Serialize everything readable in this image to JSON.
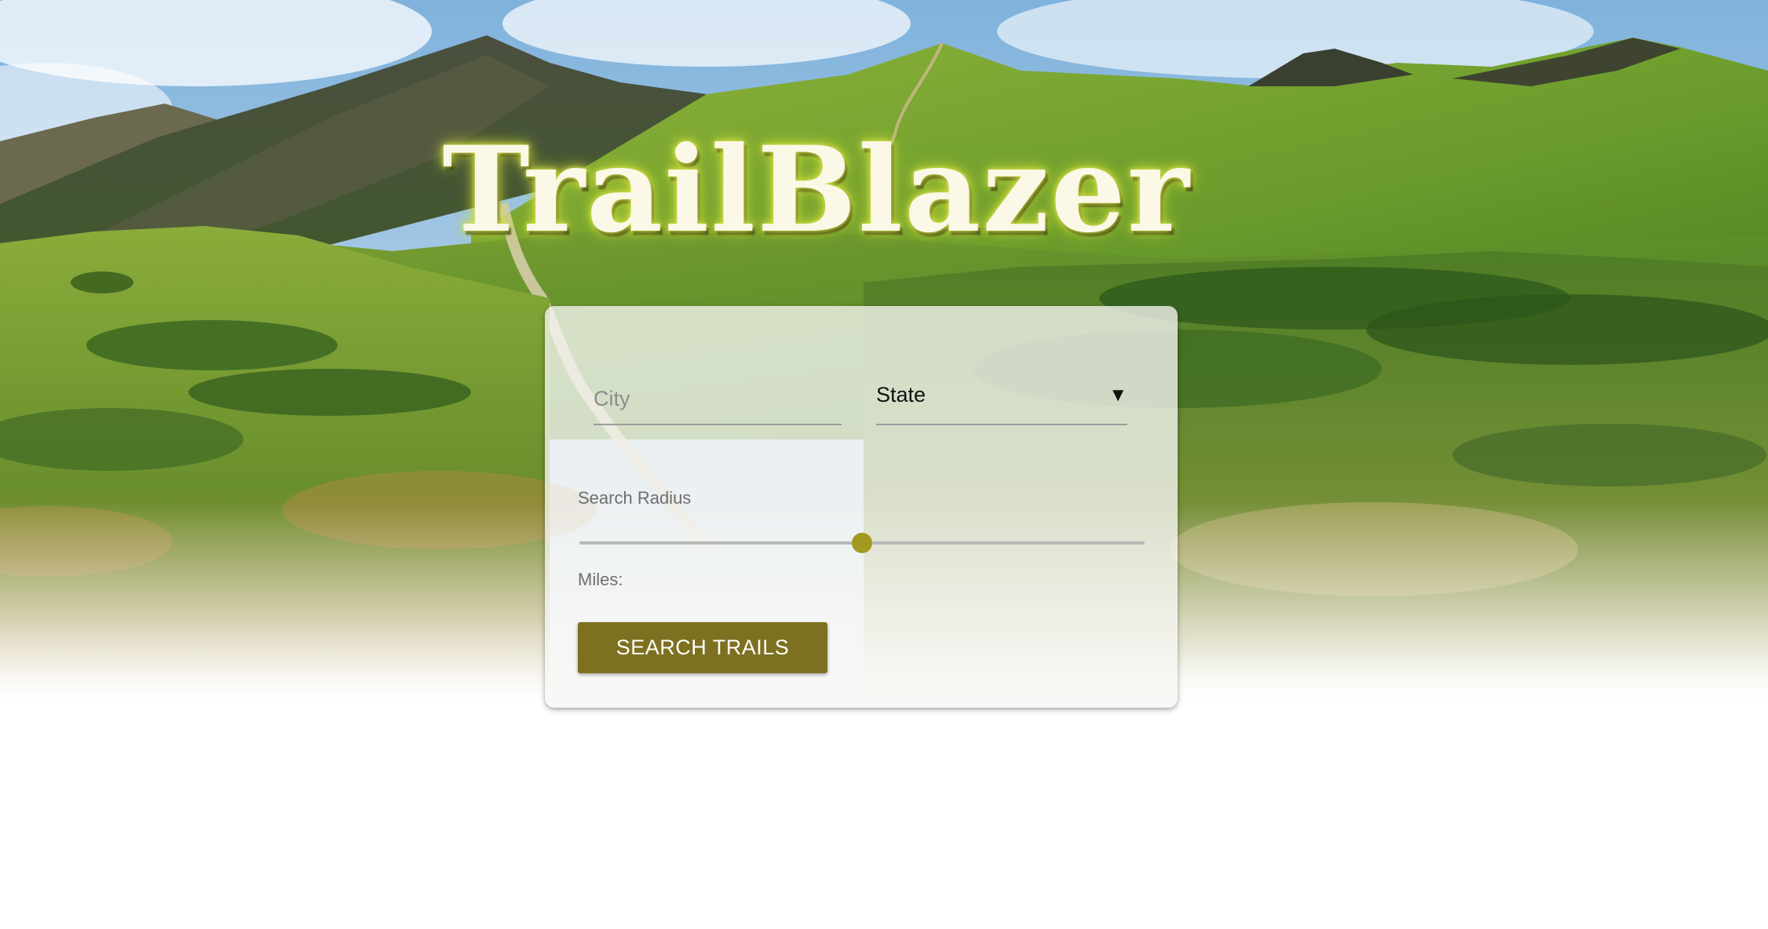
{
  "brand": {
    "logo_text": "TrailBlazer"
  },
  "search_form": {
    "city": {
      "placeholder": "City",
      "value": ""
    },
    "state": {
      "selected": "State",
      "caret_glyph": "▼"
    },
    "radius": {
      "label": "Search Radius",
      "value_fraction": 0.5
    },
    "miles": {
      "label": "Miles:",
      "value": ""
    },
    "submit_label": "SEARCH TRAILS"
  },
  "theme": {
    "accent": "#7d7020",
    "slider_thumb": "#a29a1e",
    "logo_glow": "#d7e24a",
    "card_background": "#f6f6f4"
  },
  "icons": {
    "state_caret": "chevron-down-icon"
  }
}
